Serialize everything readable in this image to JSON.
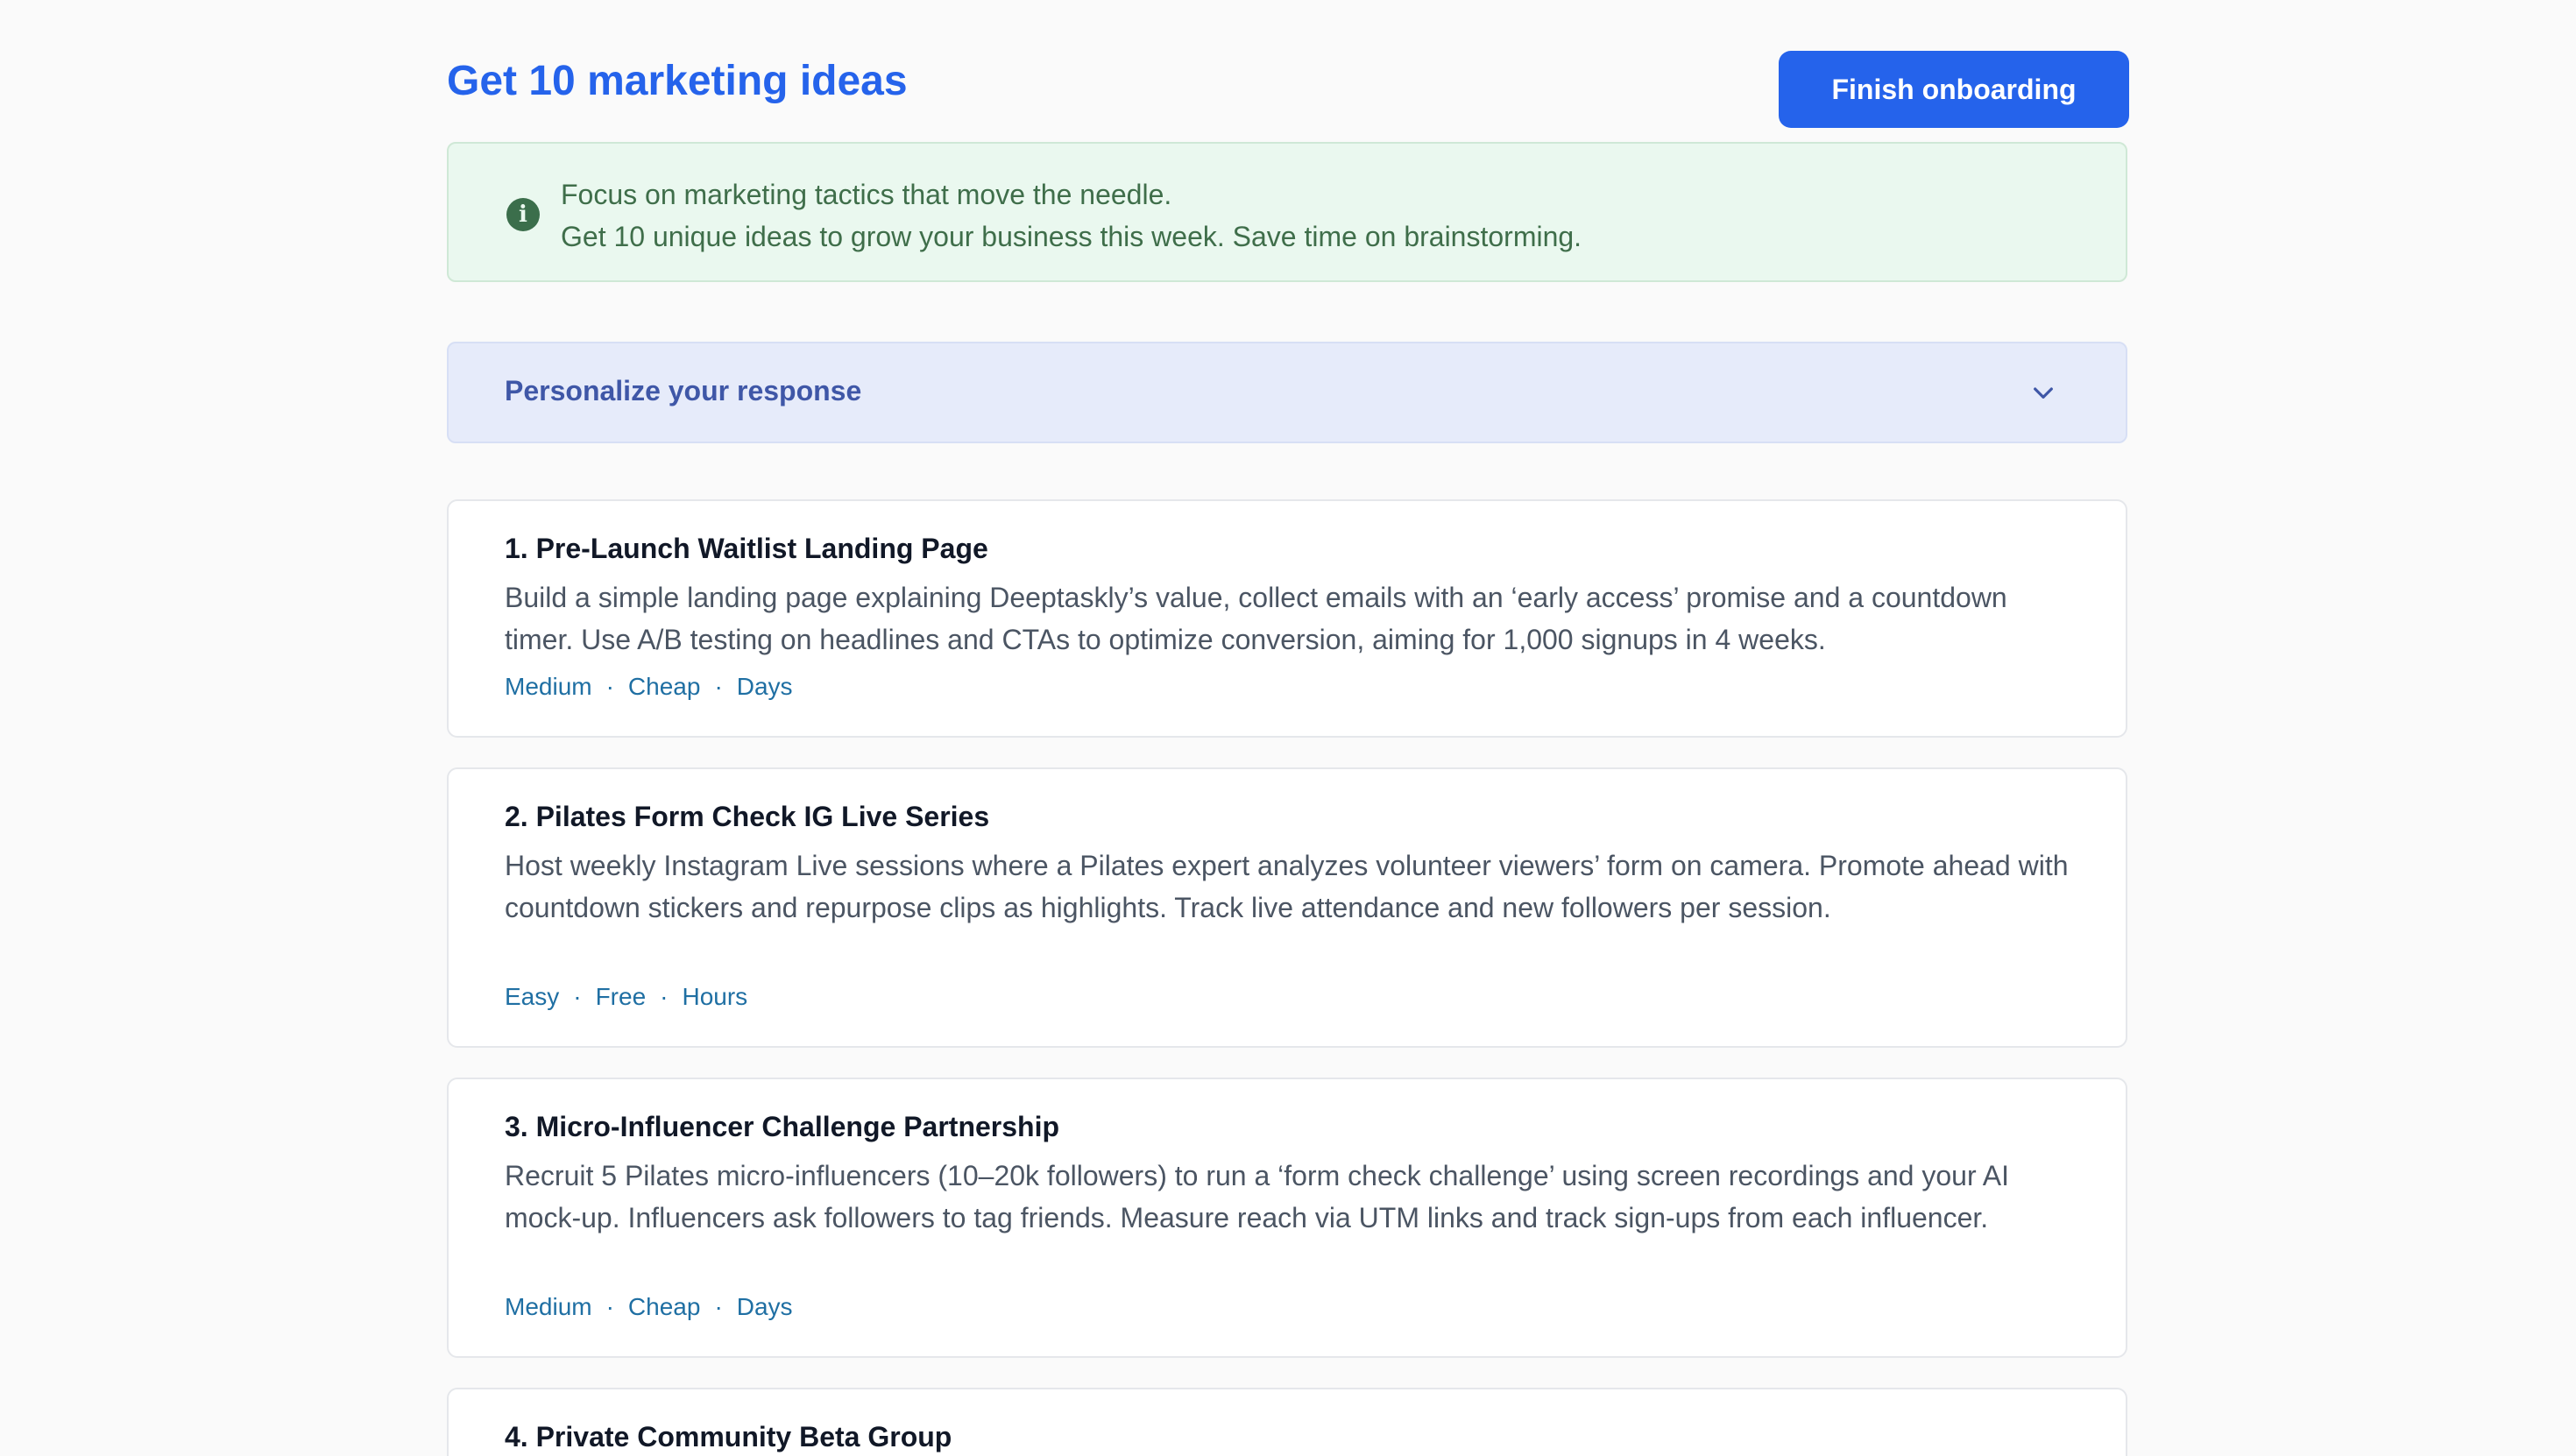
{
  "header": {
    "title": "Get 10 marketing ideas",
    "finish_label": "Finish onboarding"
  },
  "info": {
    "icon": "info-circle-icon",
    "line1": "Focus on marketing tactics that move the needle.",
    "line2": "Get 10 unique ideas to grow your business this week. Save time on brainstorming."
  },
  "personalize": {
    "label": "Personalize your response",
    "icon": "chevron-down-icon"
  },
  "ideas": [
    {
      "title": "1. Pre-Launch Waitlist Landing Page",
      "description": "Build a simple landing page explaining Deeptaskly’s value, collect emails with an ‘early access’ promise and a countdown timer. Use A/B testing on headlines and CTAs to optimize conversion, aiming for 1,000 signups in 4 weeks.",
      "difficulty": "Medium",
      "cost": "Cheap",
      "time": "Days"
    },
    {
      "title": "2. Pilates Form Check IG Live Series",
      "description": "Host weekly Instagram Live sessions where a Pilates expert analyzes volunteer viewers’ form on camera. Promote ahead with countdown stickers and repurpose clips as highlights. Track live attendance and new followers per session.",
      "difficulty": "Easy",
      "cost": "Free",
      "time": "Hours"
    },
    {
      "title": "3. Micro-Influencer Challenge Partnership",
      "description": "Recruit 5 Pilates micro-influencers (10–20k followers) to run a ‘form check challenge’ using screen recordings and your AI mock-up. Influencers ask followers to tag friends. Measure reach via UTM links and track sign-ups from each influencer.",
      "difficulty": "Medium",
      "cost": "Cheap",
      "time": "Days"
    },
    {
      "title": "4. Private Community Beta Group"
    }
  ],
  "tag_separator": "·",
  "colors": {
    "accent": "#2563eb",
    "info_bg": "#eaf8ef",
    "accordion_bg": "#e6ebfa",
    "tag": "#1f6fa3"
  }
}
